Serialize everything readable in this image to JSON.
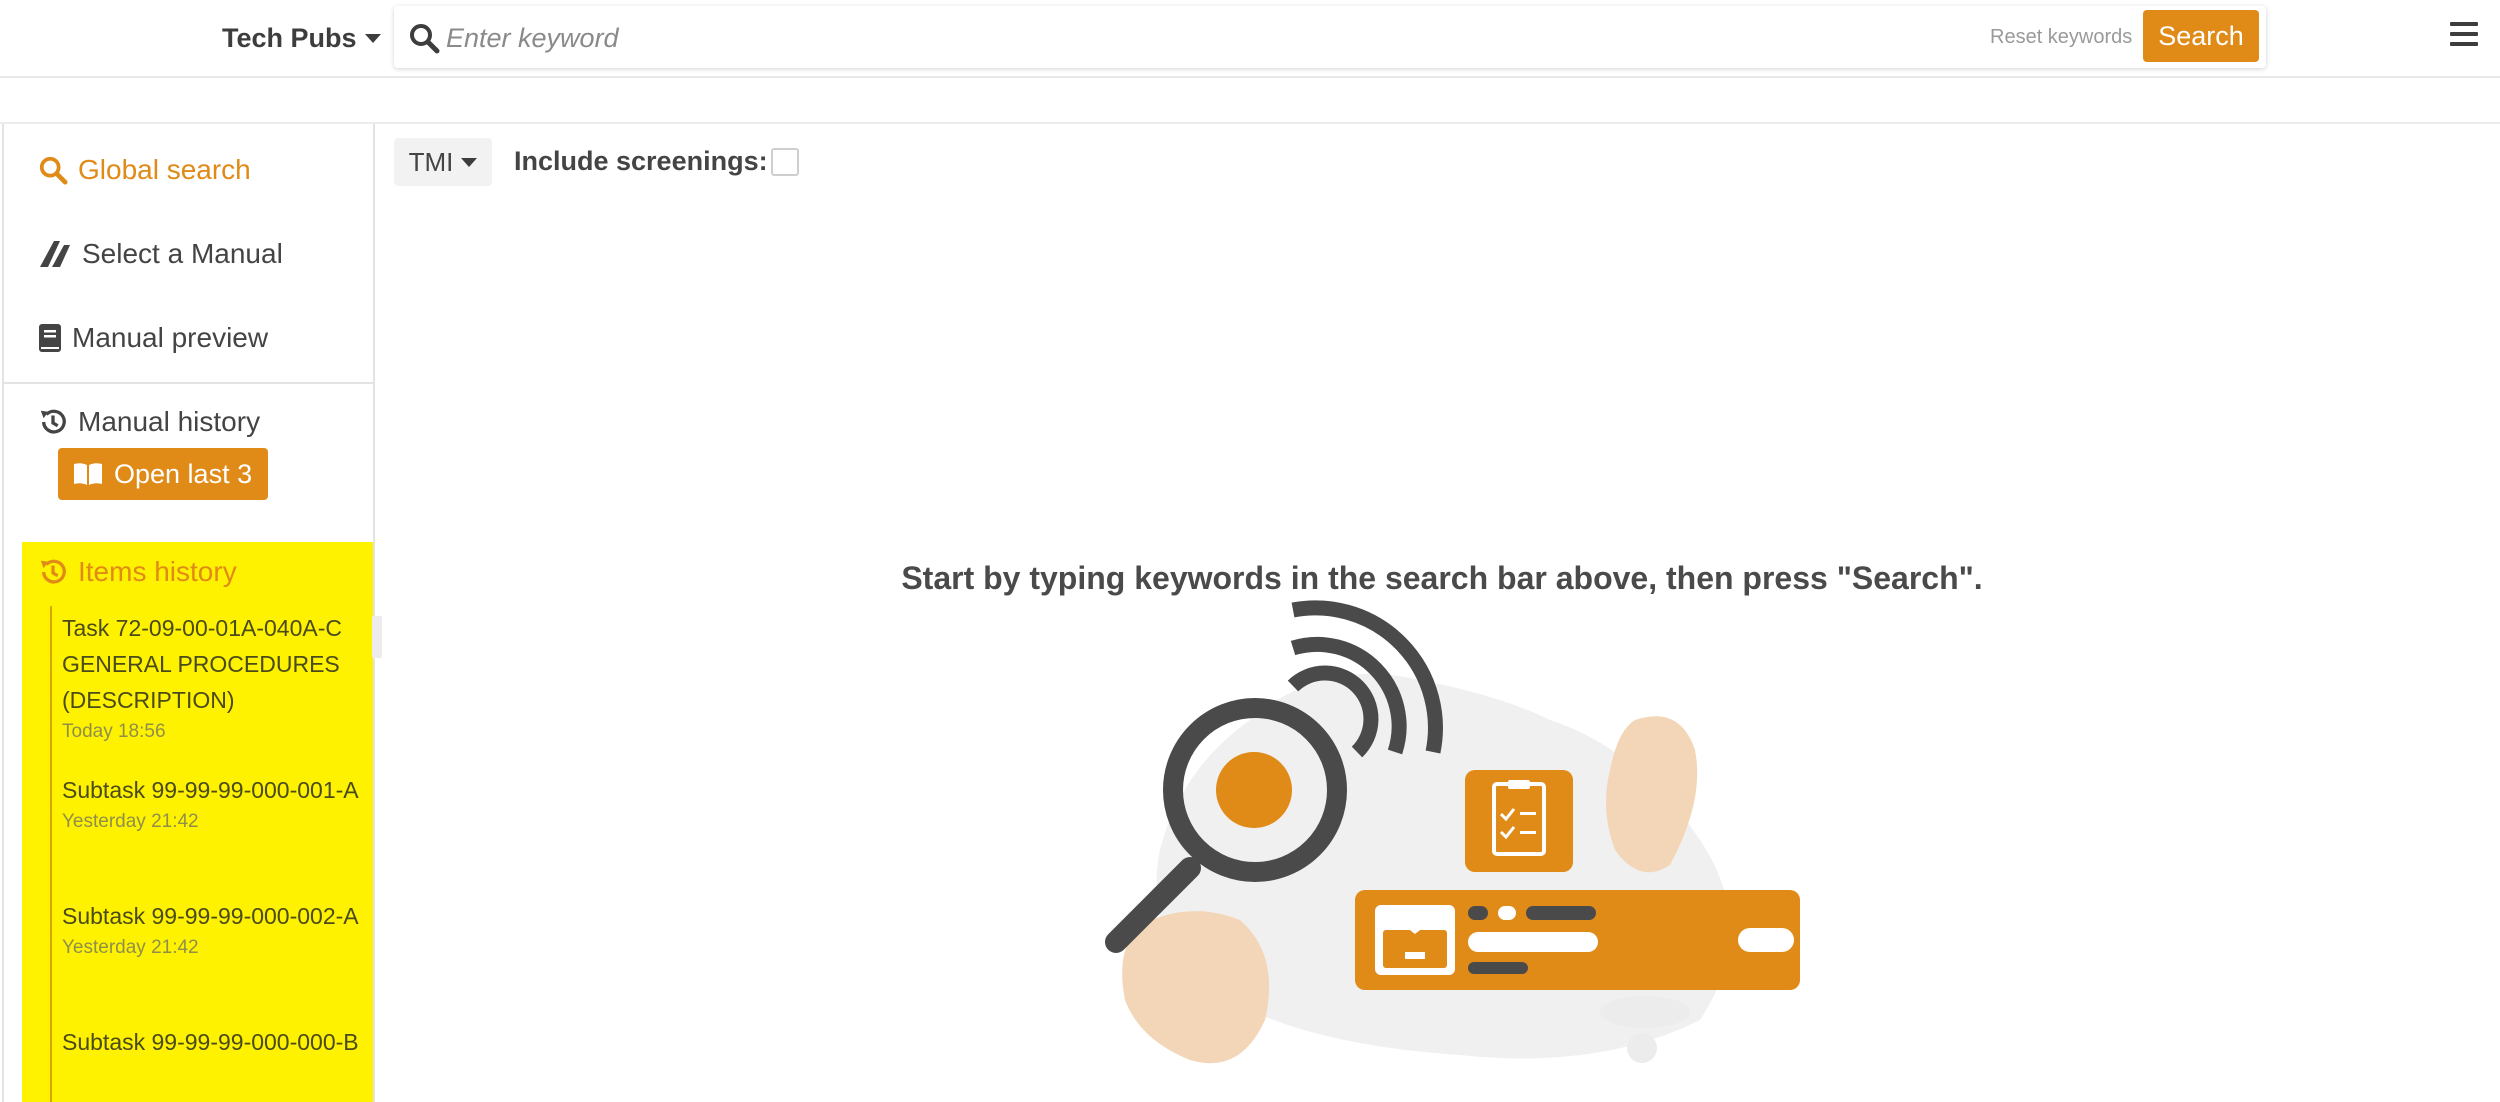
{
  "header": {
    "app_name": "Tech Pubs",
    "search_placeholder": "Enter keyword",
    "search_value": "",
    "reset_label": "Reset keywords",
    "search_button": "Search"
  },
  "sidebar": {
    "nav": [
      {
        "label": "Global search",
        "icon": "search-icon",
        "active": true
      },
      {
        "label": "Select a Manual",
        "icon": "plane-icon",
        "active": false
      },
      {
        "label": "Manual preview",
        "icon": "book-icon",
        "active": false
      }
    ],
    "manual_history": {
      "label": "Manual history",
      "open_button": "Open last 3"
    },
    "items_history": {
      "label": "Items history",
      "items": [
        {
          "title": "Task 72-09-00-01A-040A-C GENERAL PROCEDURES (DESCRIPTION)",
          "time": "Today 18:56"
        },
        {
          "title": "Subtask 99-99-99-000-001-A",
          "time": "Yesterday 21:42"
        },
        {
          "title": "Subtask 99-99-99-000-002-A",
          "time": "Yesterday 21:42"
        },
        {
          "title": "Subtask 99-99-99-000-000-B",
          "time": ""
        }
      ]
    }
  },
  "main": {
    "filter_value": "TMI",
    "include_screenings_label": "Include screenings:",
    "include_screenings_checked": false,
    "empty_message": "Start by typing keywords in the search bar above, then press \"Search\"."
  },
  "colors": {
    "accent": "#e08a17",
    "highlight": "#fff200",
    "text": "#444444"
  }
}
